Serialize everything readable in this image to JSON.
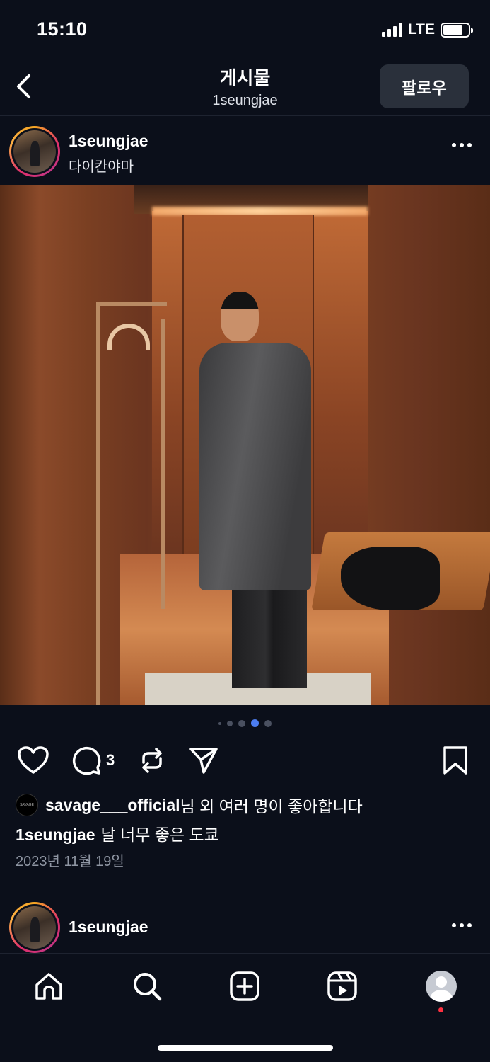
{
  "status_bar": {
    "time": "15:10",
    "network": "LTE"
  },
  "header": {
    "title": "게시물",
    "subtitle": "1seungjae",
    "follow_label": "팔로우"
  },
  "post": {
    "username": "1seungjae",
    "location": "다이칸야마",
    "carousel": {
      "total": 5,
      "active_index": 3
    },
    "comment_count": "3",
    "liked_by_user": "savage___official",
    "liked_by_suffix": "님 외 여러 명이 좋아합니다",
    "liked_by_avatar_text": "SAVAGE",
    "caption_user": "1seungjae",
    "caption_text": "날 너무 좋은 도쿄",
    "date": "2023년 11월 19일"
  },
  "next_post": {
    "username": "1seungjae"
  },
  "icons": {
    "back": "chevron-left-icon",
    "more": "more-horizontal-icon",
    "like": "heart-icon",
    "comment": "comment-icon",
    "repost": "repost-icon",
    "share": "send-icon",
    "save": "bookmark-icon"
  },
  "bottom_nav": [
    "home",
    "search",
    "create",
    "reels",
    "profile"
  ],
  "colors": {
    "background": "#0b0f1a",
    "accent_dot": "#4c7df0",
    "notification": "#ff3040"
  }
}
